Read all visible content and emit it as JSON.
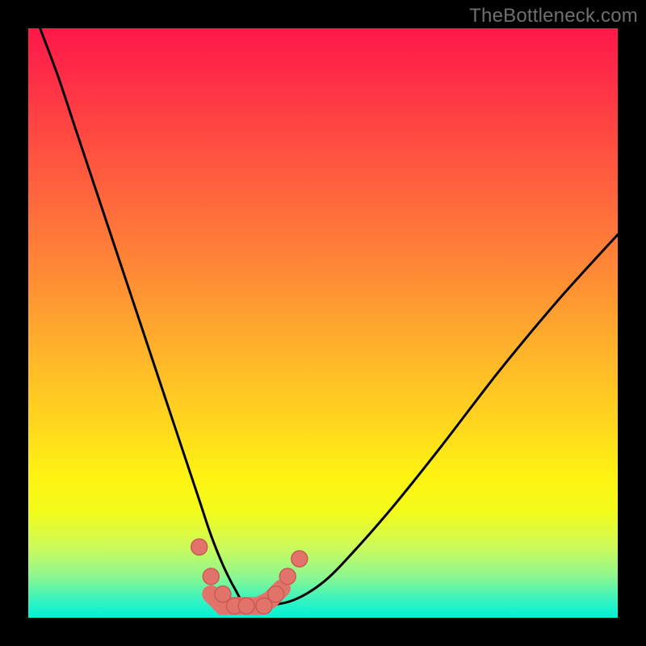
{
  "watermark": "TheBottleneck.com",
  "colors": {
    "page_bg": "#000000",
    "gradient_top": "#ff1848",
    "gradient_bottom": "#00f1d6",
    "curve": "#000000",
    "marker": "#e2736b"
  },
  "chart_data": {
    "type": "line",
    "title": "",
    "xlabel": "",
    "ylabel": "",
    "xlim": [
      0,
      100
    ],
    "ylim": [
      0,
      100
    ],
    "series": [
      {
        "name": "bottleneck-curve",
        "x": [
          2,
          5,
          8,
          11,
          14,
          17,
          20,
          23,
          26,
          29,
          31,
          33,
          35,
          37,
          40,
          45,
          50,
          55,
          62,
          70,
          80,
          90,
          100
        ],
        "y": [
          100,
          92,
          83,
          74,
          65,
          56,
          47,
          38,
          29,
          20,
          14,
          9,
          5,
          2,
          2,
          3,
          6,
          11,
          19,
          29,
          42,
          54,
          65
        ]
      }
    ],
    "markers": {
      "name": "highlighted-points",
      "x": [
        29,
        31,
        33,
        35,
        37,
        40,
        42,
        44,
        46
      ],
      "y": [
        12,
        7,
        4,
        2,
        2,
        2,
        4,
        7,
        10
      ]
    },
    "connector": {
      "name": "u-shape-bar",
      "x": [
        31,
        33,
        35,
        37,
        39,
        41,
        43
      ],
      "y": [
        4,
        2,
        2,
        2,
        2,
        3,
        5
      ]
    }
  }
}
